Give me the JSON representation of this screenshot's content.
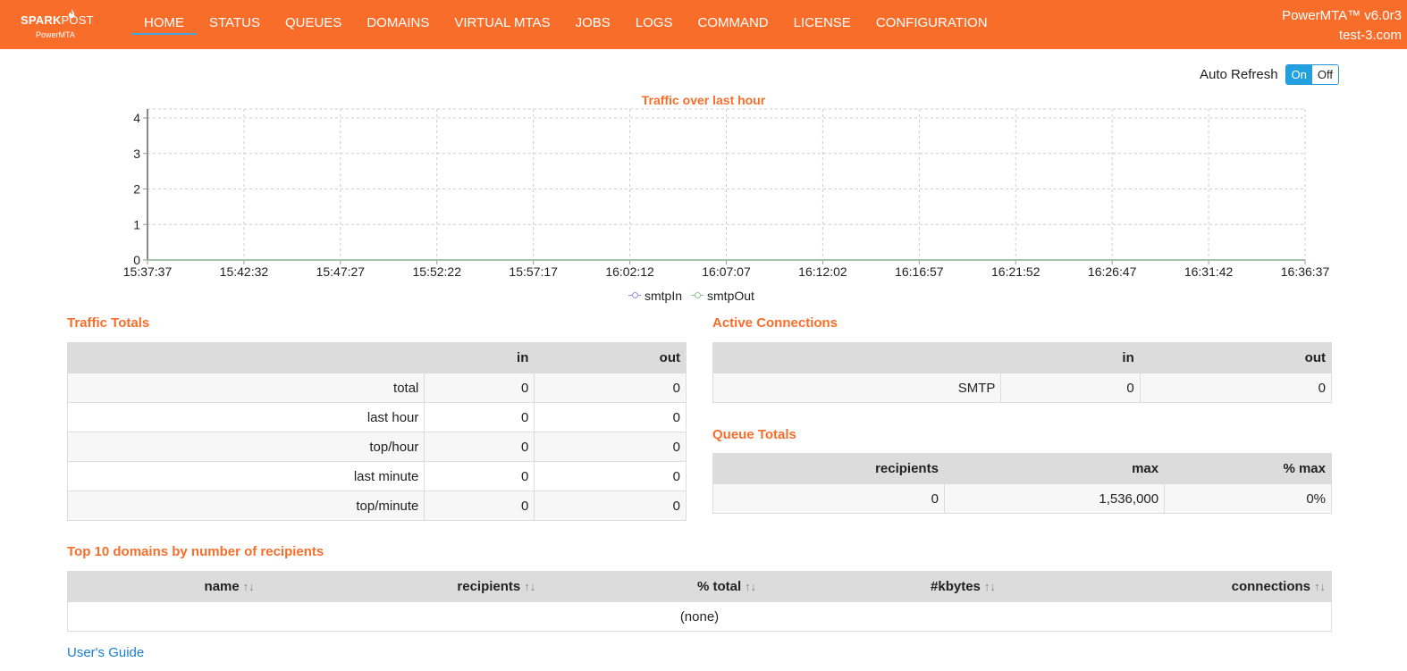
{
  "header": {
    "logo_brand": "SPARK",
    "logo_brand_thin": "POST",
    "logo_sub": "PowerMTA",
    "nav": [
      {
        "label": "HOME",
        "active": true
      },
      {
        "label": "STATUS"
      },
      {
        "label": "QUEUES"
      },
      {
        "label": "DOMAINS"
      },
      {
        "label": "VIRTUAL MTAS"
      },
      {
        "label": "JOBS"
      },
      {
        "label": "LOGS"
      },
      {
        "label": "COMMAND"
      },
      {
        "label": "LICENSE"
      },
      {
        "label": "CONFIGURATION"
      }
    ],
    "version": "PowerMTA™ v6.0r3",
    "host": "test-3.com",
    "colors": {
      "bar": "#f96d2b",
      "accent": "#4aa3df"
    }
  },
  "auto_refresh": {
    "label": "Auto Refresh",
    "on": "On",
    "off": "Off",
    "state": "On"
  },
  "chart": {
    "title": "Traffic over last hour"
  },
  "chart_data": {
    "type": "line",
    "title": "Traffic over last hour",
    "x": [
      "15:37:37",
      "15:42:32",
      "15:47:27",
      "15:52:22",
      "15:57:17",
      "16:02:12",
      "16:07:07",
      "16:12:02",
      "16:16:57",
      "16:21:52",
      "16:26:47",
      "16:31:42",
      "16:36:37"
    ],
    "y_ticks": [
      0,
      1,
      2,
      3,
      4
    ],
    "ylim": [
      0,
      4
    ],
    "grid": true,
    "legend": "bottom-center",
    "series": [
      {
        "name": "smtpIn",
        "color": "#8f8fe8",
        "values": [
          0,
          0,
          0,
          0,
          0,
          0,
          0,
          0,
          0,
          0,
          0,
          0,
          0
        ]
      },
      {
        "name": "smtpOut",
        "color": "#8cc98c",
        "values": [
          0,
          0,
          0,
          0,
          0,
          0,
          0,
          0,
          0,
          0,
          0,
          0,
          0
        ]
      }
    ]
  },
  "traffic_totals": {
    "title": "Traffic Totals",
    "columns": [
      "",
      "in",
      "out"
    ],
    "rows": [
      [
        "total",
        "0",
        "0"
      ],
      [
        "last hour",
        "0",
        "0"
      ],
      [
        "top/hour",
        "0",
        "0"
      ],
      [
        "last minute",
        "0",
        "0"
      ],
      [
        "top/minute",
        "0",
        "0"
      ]
    ]
  },
  "active_connections": {
    "title": "Active Connections",
    "columns": [
      "",
      "in",
      "out"
    ],
    "rows": [
      [
        "SMTP",
        "0",
        "0"
      ]
    ]
  },
  "queue_totals": {
    "title": "Queue Totals",
    "columns": [
      "recipients",
      "max",
      "% max"
    ],
    "rows": [
      [
        "0",
        "1,536,000",
        "0%"
      ]
    ]
  },
  "top_domains": {
    "title": "Top 10 domains by number of recipients",
    "columns": [
      "name",
      "recipients",
      "% total",
      "#kbytes",
      "connections"
    ],
    "sort_glyph": "↑↓",
    "empty": "(none)"
  },
  "footer": {
    "guide_link": "User's Guide"
  }
}
